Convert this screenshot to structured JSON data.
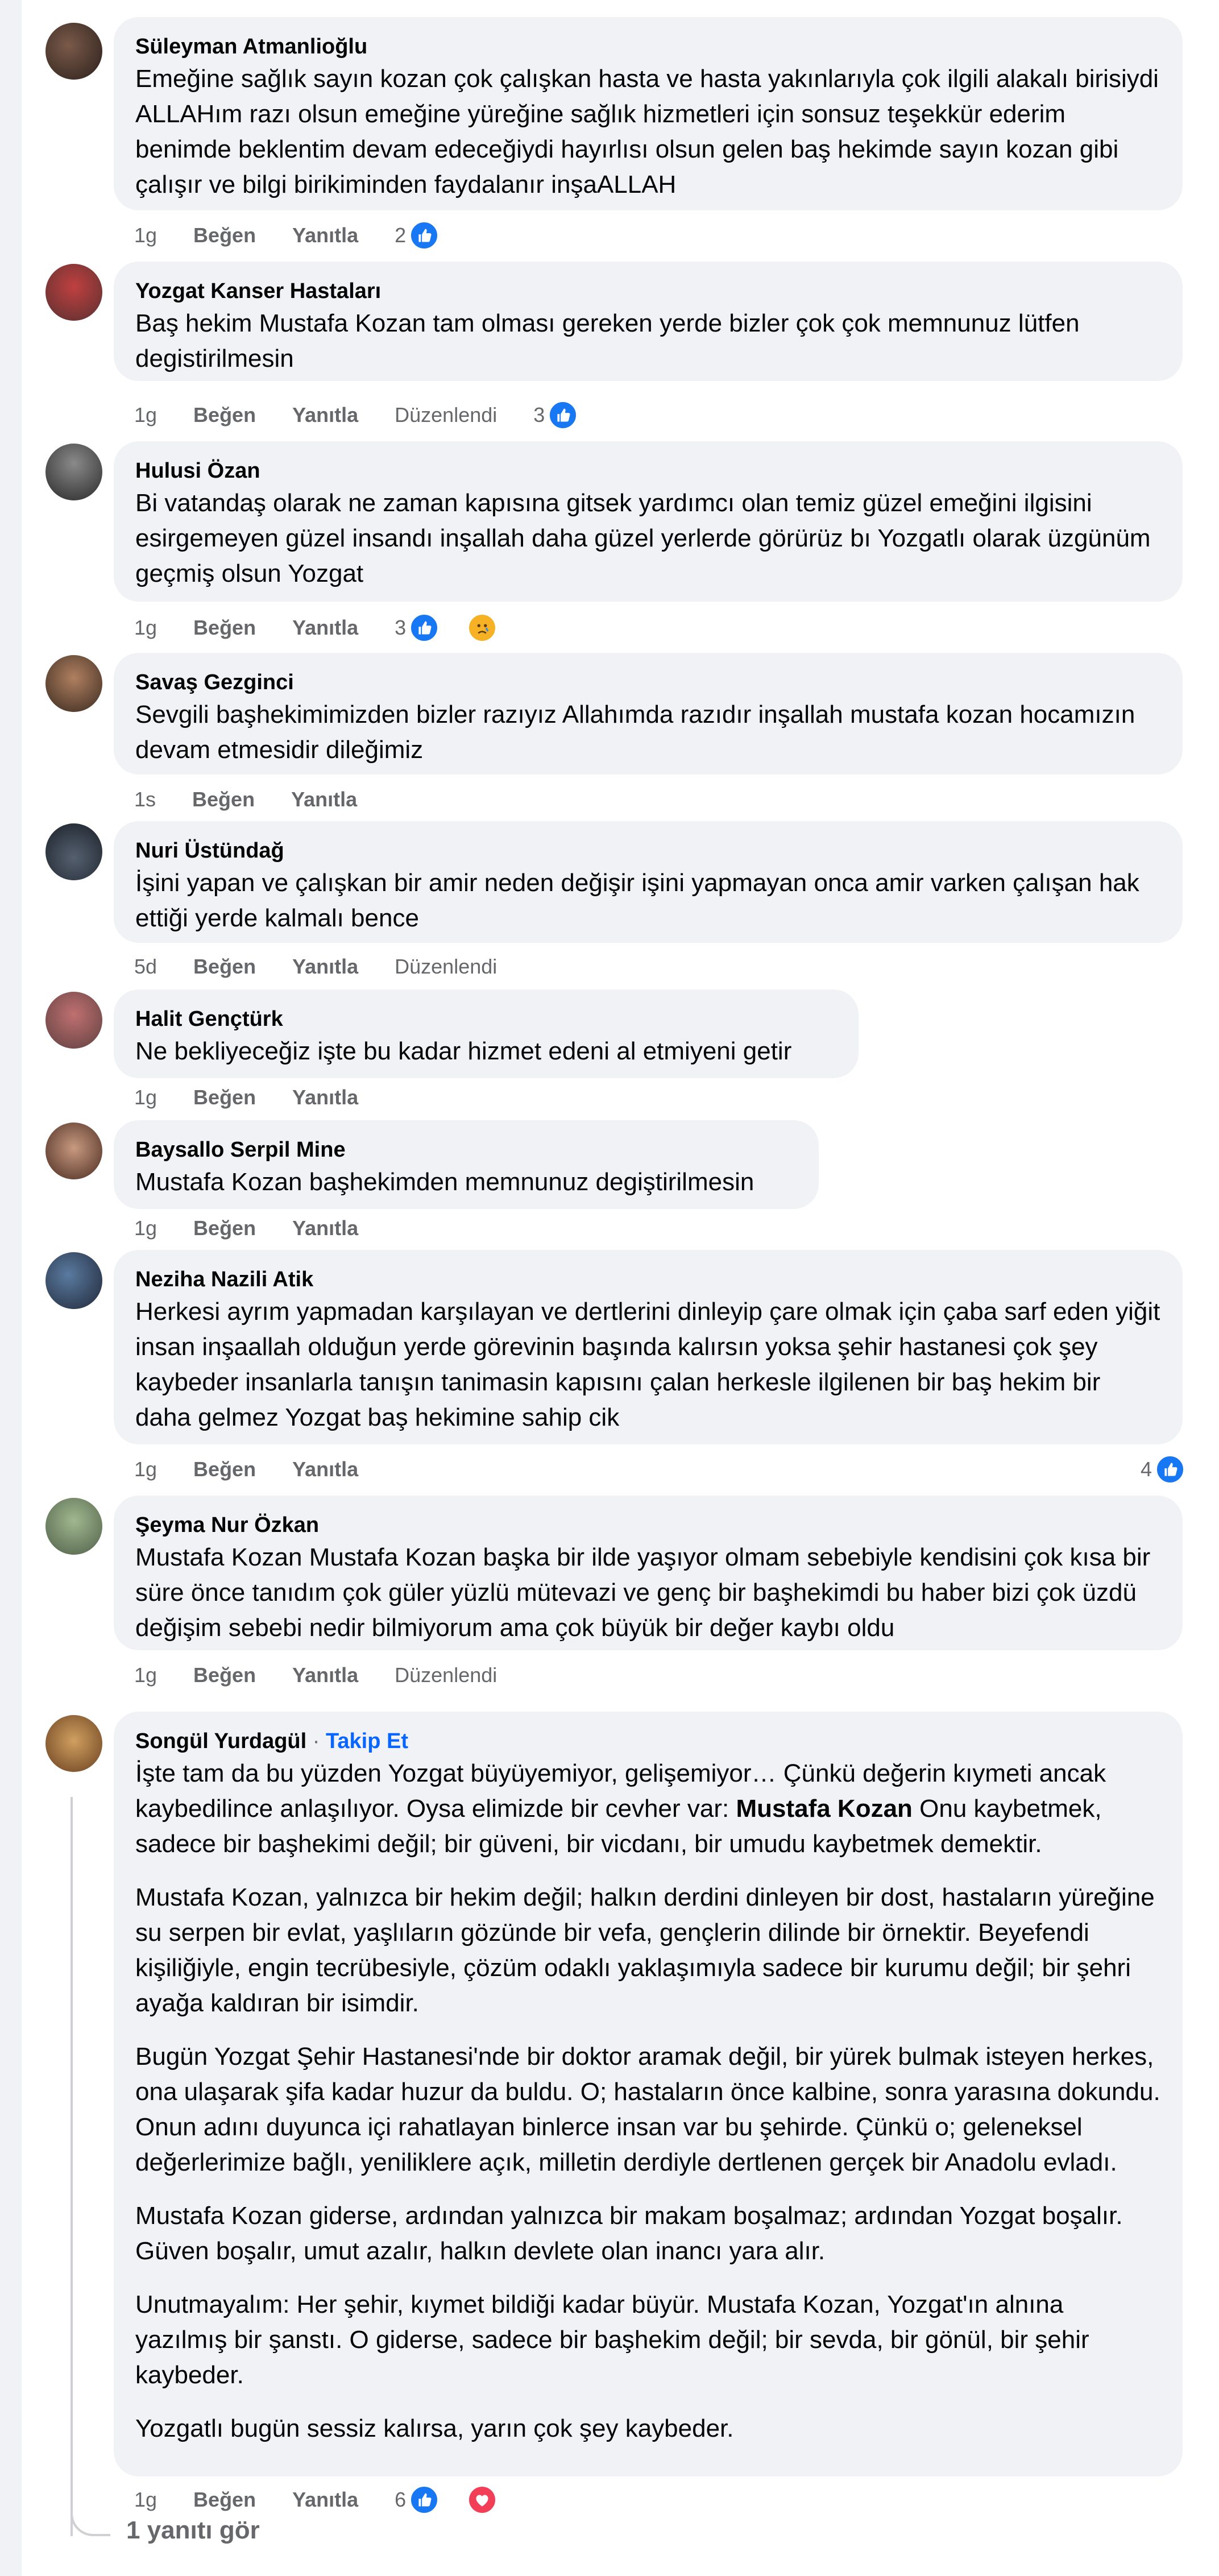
{
  "comments": [
    {
      "author": "Süleyman Atmanlioğlu",
      "text": "Emeğine sağlık sayın kozan çok çalışkan hasta ve hasta yakınlarıyla çok ilgili alakalı birisiydi ALLAHım razı olsun emeğine yüreğine sağlık hizmetleri için sonsuz teşekkür ederim benimde beklentim devam edeceğiydi hayırlısı olsun gelen baş hekimde sayın kozan gibi çalışır ve bilgi birikiminden faydalanır inşaALLAH",
      "time": "1g",
      "like_label": "Beğen",
      "reply_label": "Yanıtla",
      "edited_label": "",
      "reaction_count": "2"
    },
    {
      "author": "Yozgat Kanser Hastaları",
      "text": "Baş hekim Mustafa Kozan tam olması gereken yerde bizler çok çok memnunuz lütfen degistirilmesin",
      "time": "1g",
      "like_label": "Beğen",
      "reply_label": "Yanıtla",
      "edited_label": "Düzenlendi",
      "reaction_count": "3"
    },
    {
      "author": "Hulusi Özan",
      "text": "Bi vatandaş olarak ne zaman kapısına gitsek yardımcı olan temiz güzel emeğini ilgisini esirgemeyen güzel insandı inşallah daha güzel yerlerde görürüz bı Yozgatlı olarak üzgünüm geçmiş olsun Yozgat",
      "time": "1g",
      "like_label": "Beğen",
      "reply_label": "Yanıtla",
      "edited_label": "",
      "reaction_count": "3"
    },
    {
      "author": "Savaş Gezginci",
      "text": "Sevgili başhekimimizden bizler razıyız Allahımda razıdır inşallah mustafa kozan hocamızın devam etmesidir dileğimiz",
      "time": "1s",
      "like_label": "Beğen",
      "reply_label": "Yanıtla",
      "edited_label": "",
      "reaction_count": ""
    },
    {
      "author": "Nuri Üstündağ",
      "text": "İşini yapan ve çalışkan bir amir neden değişir işini yapmayan onca amir varken çalışan hak ettiği yerde kalmalı bence",
      "time": "5d",
      "like_label": "Beğen",
      "reply_label": "Yanıtla",
      "edited_label": "Düzenlendi",
      "reaction_count": ""
    },
    {
      "author": "Halit Gençtürk",
      "text": "Ne bekliyeceğiz işte bu kadar hizmet edeni al etmiyeni getir",
      "time": "1g",
      "like_label": "Beğen",
      "reply_label": "Yanıtla",
      "edited_label": "",
      "reaction_count": ""
    },
    {
      "author": "Baysallo Serpil Mine",
      "text": "Mustafa Kozan başhekimden memnunuz degiştirilmesin",
      "time": "1g",
      "like_label": "Beğen",
      "reply_label": "Yanıtla",
      "edited_label": "",
      "reaction_count": ""
    },
    {
      "author": "Neziha Nazili Atik",
      "text": "Herkesi ayrım yapmadan karşılayan ve dertlerini dinleyip çare olmak için çaba sarf eden yiğit insan inşaallah olduğun yerde görevinin başında kalırsın yoksa şehir hastanesi çok şey kaybeder insanlarla tanışın tanimasin kapısını çalan herkesle ilgilenen bir baş hekim bir daha gelmez Yozgat baş hekimine sahip cik",
      "time": "1g",
      "like_label": "Beğen",
      "reply_label": "Yanıtla",
      "edited_label": "",
      "reaction_count": "4"
    },
    {
      "author": "Şeyma Nur Özkan",
      "text": "Mustafa Kozan Mustafa Kozan başka bir ilde yaşıyor olmam sebebiyle kendisini çok kısa bir süre önce tanıdım çok güler yüzlü mütevazi ve genç bir başhekimdi bu haber bizi çok üzdü değişim sebebi nedir bilmiyorum ama çok büyük bir değer kaybı oldu",
      "time": "1g",
      "like_label": "Beğen",
      "reply_label": "Yanıtla",
      "edited_label": "Düzenlendi",
      "reaction_count": ""
    }
  ],
  "long_comment": {
    "author": "Songül Yurdagül",
    "separator": " · ",
    "follow_label": "Takip Et",
    "p1_before": "İşte tam da bu yüzden Yozgat büyüyemiyor, gelişemiyor… Çünkü değerin kıymeti ancak kaybedilince anlaşılıyor. Oysa elimizde bir cevher var: ",
    "p1_bold": "Mustafa Kozan",
    "p1_after": " Onu kaybetmek, sadece bir başhekimi değil; bir güveni, bir vicdanı, bir umudu kaybetmek demektir.",
    "p2": "Mustafa Kozan, yalnızca bir hekim değil; halkın derdini dinleyen bir dost, hastaların yüreğine su serpen bir evlat, yaşlıların gözünde bir vefa, gençlerin dilinde bir örnektir. Beyefendi kişiliğiyle, engin tecrübesiyle, çözüm odaklı yaklaşımıyla sadece bir kurumu değil; bir şehri ayağa kaldıran bir isimdir.",
    "p3": "Bugün Yozgat Şehir Hastanesi'nde bir doktor aramak değil, bir yürek bulmak isteyen herkes, ona ulaşarak şifa kadar huzur da buldu. O; hastaların önce kalbine, sonra yarasına dokundu. Onun adını duyunca içi rahatlayan binlerce insan var bu şehirde. Çünkü o; geleneksel değerlerimize bağlı, yeniliklere açık, milletin derdiyle dertlenen gerçek bir Anadolu evladı.",
    "p4": "Mustafa Kozan giderse, ardından yalnızca bir makam boşalmaz; ardından Yozgat boşalır. Güven boşalır, umut azalır, halkın devlete olan inancı yara alır.",
    "p5": "Unutmayalım: Her şehir, kıymet bildiği kadar büyür. Mustafa Kozan, Yozgat'ın alnına yazılmış bir şanstı. O giderse, sadece bir başhekim değil; bir sevda, bir gönül, bir şehir kaybeder.",
    "p6": "Yozgatlı bugün sessiz kalırsa, yarın çok şey kaybeder.",
    "time": "1g",
    "like_label": "Beğen",
    "reply_label": "Yanıtla",
    "reaction_count": "6"
  },
  "view_replies_label": "1 yanıtı gör",
  "icons": [
    "like-reaction-icon",
    "sad-reaction-icon",
    "love-reaction-icon"
  ],
  "colors": {
    "bubble": "#f0f2f5",
    "like": "#1877f2",
    "link": "#0866ff",
    "meta": "#65676b"
  }
}
